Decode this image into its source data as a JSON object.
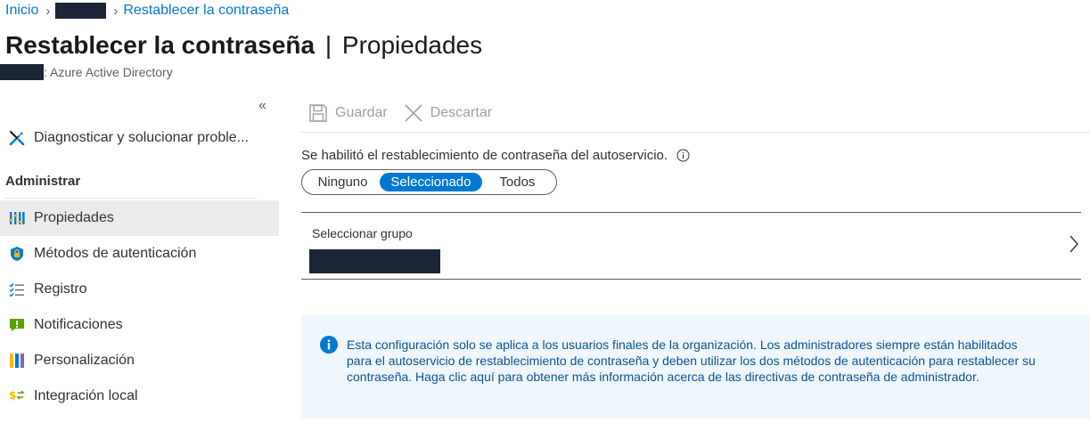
{
  "breadcrumb": {
    "home": "Inicio",
    "current": "Restablecer la contraseña"
  },
  "page": {
    "title": "Restablecer la contraseña",
    "separator": "|",
    "subtitle_section": "Propiedades",
    "directory": ": Azure Active Directory"
  },
  "sidebar": {
    "diagnose": "Diagnosticar y solucionar proble...",
    "section_header": "Administrar",
    "items": [
      {
        "label": "Propiedades",
        "icon": "properties-icon",
        "active": true
      },
      {
        "label": "Métodos de autenticación",
        "icon": "shield-icon",
        "active": false
      },
      {
        "label": "Registro",
        "icon": "checklist-icon",
        "active": false
      },
      {
        "label": "Notificaciones",
        "icon": "notification-icon",
        "active": false
      },
      {
        "label": "Personalización",
        "icon": "customization-icon",
        "active": false
      },
      {
        "label": "Integración local",
        "icon": "onprem-sync-icon",
        "active": false
      }
    ],
    "collapse_glyph": "«"
  },
  "toolbar": {
    "save": "Guardar",
    "discard": "Descartar"
  },
  "sspr": {
    "label": "Se habilitó el restablecimiento de contraseña del autoservicio.",
    "options": [
      "Ninguno",
      "Seleccionado",
      "Todos"
    ],
    "selected": "Seleccionado"
  },
  "group": {
    "label": "Seleccionar grupo"
  },
  "banner": {
    "text": "Esta configuración solo se aplica a los usuarios finales de la organización. Los administradores siempre están habilitados para el autoservicio de restablecimiento de contraseña y deben utilizar los dos métodos de autenticación para restablecer su contraseña. Haga clic aquí para obtener más información acerca de las directivas de contraseña de administrador."
  },
  "colors": {
    "accent": "#0078d4",
    "redaction": "#1b2535",
    "banner_bg": "#eff6fc",
    "active_nav_bg": "#edebe9"
  }
}
